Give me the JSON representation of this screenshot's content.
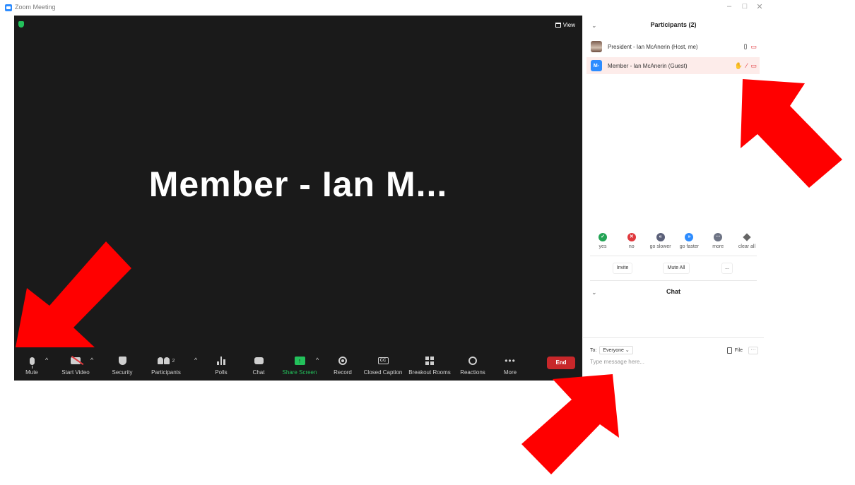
{
  "window": {
    "title": "Zoom Meeting",
    "controls": [
      "–",
      "□",
      "✕"
    ]
  },
  "video": {
    "view_label": "View",
    "speaker_name": "Member - Ian M..."
  },
  "toolbar": {
    "mute": "Mute",
    "start_video": "Start Video",
    "security": "Security",
    "participants": "Participants",
    "participants_count": "2",
    "polls": "Polls",
    "chat": "Chat",
    "share_screen": "Share Screen",
    "record": "Record",
    "closed_caption": "Closed Caption",
    "cc_glyph": "CC",
    "breakout_rooms": "Breakout Rooms",
    "reactions": "Reactions",
    "more": "More",
    "end": "End",
    "caret": "^",
    "share_glyph": "↑"
  },
  "participants": {
    "header": "Participants (2)",
    "collapse_glyph": "⌄",
    "list": [
      {
        "name": "President - Ian McAnerin (Host, me)",
        "avatar": ""
      },
      {
        "name": "Member - Ian McAnerin (Guest)",
        "avatar": "M-"
      }
    ],
    "feedback": [
      {
        "label": "yes",
        "glyph": "✓",
        "color": "#23a455"
      },
      {
        "label": "no",
        "glyph": "✕",
        "color": "#e0393e"
      },
      {
        "label": "go slower",
        "glyph": "«",
        "color": "#5b6079"
      },
      {
        "label": "go faster",
        "glyph": "»",
        "color": "#2d8cff"
      },
      {
        "label": "more",
        "glyph": "···",
        "color": "#6d7384"
      },
      {
        "label": "clear all",
        "glyph": "",
        "color": "#666666"
      }
    ],
    "invite": "Invite",
    "mute_all": "Mute All",
    "more": "..."
  },
  "chat": {
    "header": "Chat",
    "to_label": "To:",
    "recipient": "Everyone ⌄",
    "file_label": "File",
    "more": "···",
    "placeholder": "Type message here..."
  },
  "colors": {
    "video_bg": "#1a1a1a",
    "accent_blue": "#2d8cff",
    "share_green": "#23c15b",
    "end_red": "#c8272a",
    "arrow_red": "#ff0000"
  }
}
